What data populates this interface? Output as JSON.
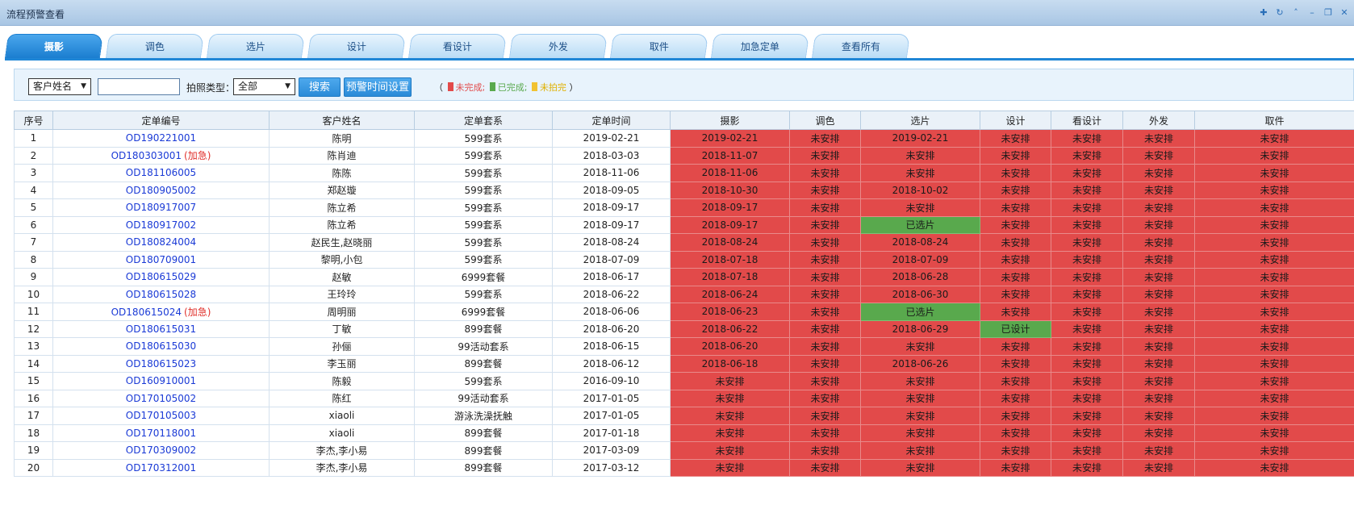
{
  "window": {
    "title": "流程预警查看"
  },
  "tabs": [
    "摄影",
    "调色",
    "选片",
    "设计",
    "看设计",
    "外发",
    "取件",
    "加急定单",
    "查看所有"
  ],
  "active_tab": "摄影",
  "search": {
    "field_select": "客户姓名",
    "field_input": "",
    "type_label": "拍照类型：",
    "type_select": "全部",
    "search_button": "搜索",
    "warn_button": "预警时间设置",
    "legend_open": "（",
    "legend_incomplete": "未完成;",
    "legend_done": "已完成;",
    "legend_notshot": "未拍完",
    "legend_close": "）",
    "colors": {
      "incomplete": "#e24a4a",
      "done": "#59a94d",
      "notshot": "#f1c232"
    }
  },
  "table": {
    "headers": [
      "序号",
      "定单编号",
      "客户姓名",
      "定单套系",
      "定单时间",
      "摄影",
      "调色",
      "选片",
      "设计",
      "看设计",
      "外发",
      "取件"
    ],
    "rows": [
      {
        "no": "1",
        "order": "OD190221001",
        "urg": "",
        "name": "陈明",
        "pkg": "599套系",
        "date": "2019-02-21",
        "stages": [
          "2019-02-21",
          "未安排",
          "2019-02-21",
          "未安排",
          "未安排",
          "未安排",
          "未安排"
        ],
        "status": [
          "r",
          "r",
          "r",
          "r",
          "r",
          "r",
          "r"
        ]
      },
      {
        "no": "2",
        "order": "OD180303001",
        "urg": "(加急)",
        "name": "陈肖迪",
        "pkg": "599套系",
        "date": "2018-03-03",
        "stages": [
          "2018-11-07",
          "未安排",
          "未安排",
          "未安排",
          "未安排",
          "未安排",
          "未安排"
        ],
        "status": [
          "r",
          "r",
          "r",
          "r",
          "r",
          "r",
          "r"
        ]
      },
      {
        "no": "3",
        "order": "OD181106005",
        "urg": "",
        "name": "陈陈",
        "pkg": "599套系",
        "date": "2018-11-06",
        "stages": [
          "2018-11-06",
          "未安排",
          "未安排",
          "未安排",
          "未安排",
          "未安排",
          "未安排"
        ],
        "status": [
          "r",
          "r",
          "r",
          "r",
          "r",
          "r",
          "r"
        ]
      },
      {
        "no": "4",
        "order": "OD180905002",
        "urg": "",
        "name": "郑赵璇",
        "pkg": "599套系",
        "date": "2018-09-05",
        "stages": [
          "2018-10-30",
          "未安排",
          "2018-10-02",
          "未安排",
          "未安排",
          "未安排",
          "未安排"
        ],
        "status": [
          "r",
          "r",
          "r",
          "r",
          "r",
          "r",
          "r"
        ]
      },
      {
        "no": "5",
        "order": "OD180917007",
        "urg": "",
        "name": "陈立希",
        "pkg": "599套系",
        "date": "2018-09-17",
        "stages": [
          "2018-09-17",
          "未安排",
          "未安排",
          "未安排",
          "未安排",
          "未安排",
          "未安排"
        ],
        "status": [
          "r",
          "r",
          "r",
          "r",
          "r",
          "r",
          "r"
        ]
      },
      {
        "no": "6",
        "order": "OD180917002",
        "urg": "",
        "name": "陈立希",
        "pkg": "599套系",
        "date": "2018-09-17",
        "stages": [
          "2018-09-17",
          "未安排",
          "已选片",
          "未安排",
          "未安排",
          "未安排",
          "未安排"
        ],
        "status": [
          "r",
          "r",
          "g",
          "r",
          "r",
          "r",
          "r"
        ]
      },
      {
        "no": "7",
        "order": "OD180824004",
        "urg": "",
        "name": "赵民生,赵晓丽",
        "pkg": "599套系",
        "date": "2018-08-24",
        "stages": [
          "2018-08-24",
          "未安排",
          "2018-08-24",
          "未安排",
          "未安排",
          "未安排",
          "未安排"
        ],
        "status": [
          "r",
          "r",
          "r",
          "r",
          "r",
          "r",
          "r"
        ]
      },
      {
        "no": "8",
        "order": "OD180709001",
        "urg": "",
        "name": "黎明,小包",
        "pkg": "599套系",
        "date": "2018-07-09",
        "stages": [
          "2018-07-18",
          "未安排",
          "2018-07-09",
          "未安排",
          "未安排",
          "未安排",
          "未安排"
        ],
        "status": [
          "r",
          "r",
          "r",
          "r",
          "r",
          "r",
          "r"
        ]
      },
      {
        "no": "9",
        "order": "OD180615029",
        "urg": "",
        "name": "赵敏",
        "pkg": "6999套餐",
        "date": "2018-06-17",
        "stages": [
          "2018-07-18",
          "未安排",
          "2018-06-28",
          "未安排",
          "未安排",
          "未安排",
          "未安排"
        ],
        "status": [
          "r",
          "r",
          "r",
          "r",
          "r",
          "r",
          "r"
        ]
      },
      {
        "no": "10",
        "order": "OD180615028",
        "urg": "",
        "name": "王玲玲",
        "pkg": "599套系",
        "date": "2018-06-22",
        "stages": [
          "2018-06-24",
          "未安排",
          "2018-06-30",
          "未安排",
          "未安排",
          "未安排",
          "未安排"
        ],
        "status": [
          "r",
          "r",
          "r",
          "r",
          "r",
          "r",
          "r"
        ]
      },
      {
        "no": "11",
        "order": "OD180615024",
        "urg": "(加急)",
        "name": "周明丽",
        "pkg": "6999套餐",
        "date": "2018-06-06",
        "stages": [
          "2018-06-23",
          "未安排",
          "已选片",
          "未安排",
          "未安排",
          "未安排",
          "未安排"
        ],
        "status": [
          "r",
          "r",
          "g",
          "r",
          "r",
          "r",
          "r"
        ]
      },
      {
        "no": "12",
        "order": "OD180615031",
        "urg": "",
        "name": "丁敏",
        "pkg": "899套餐",
        "date": "2018-06-20",
        "stages": [
          "2018-06-22",
          "未安排",
          "2018-06-29",
          "已设计",
          "未安排",
          "未安排",
          "未安排"
        ],
        "status": [
          "r",
          "r",
          "r",
          "g",
          "r",
          "r",
          "r"
        ]
      },
      {
        "no": "13",
        "order": "OD180615030",
        "urg": "",
        "name": "孙俪",
        "pkg": "99活动套系",
        "date": "2018-06-15",
        "stages": [
          "2018-06-20",
          "未安排",
          "未安排",
          "未安排",
          "未安排",
          "未安排",
          "未安排"
        ],
        "status": [
          "r",
          "r",
          "r",
          "r",
          "r",
          "r",
          "r"
        ]
      },
      {
        "no": "14",
        "order": "OD180615023",
        "urg": "",
        "name": "李玉丽",
        "pkg": "899套餐",
        "date": "2018-06-12",
        "stages": [
          "2018-06-18",
          "未安排",
          "2018-06-26",
          "未安排",
          "未安排",
          "未安排",
          "未安排"
        ],
        "status": [
          "r",
          "r",
          "r",
          "r",
          "r",
          "r",
          "r"
        ]
      },
      {
        "no": "15",
        "order": "OD160910001",
        "urg": "",
        "name": "陈毅",
        "pkg": "599套系",
        "date": "2016-09-10",
        "stages": [
          "未安排",
          "未安排",
          "未安排",
          "未安排",
          "未安排",
          "未安排",
          "未安排"
        ],
        "status": [
          "r",
          "r",
          "r",
          "r",
          "r",
          "r",
          "r"
        ]
      },
      {
        "no": "16",
        "order": "OD170105002",
        "urg": "",
        "name": "陈红",
        "pkg": "99活动套系",
        "date": "2017-01-05",
        "stages": [
          "未安排",
          "未安排",
          "未安排",
          "未安排",
          "未安排",
          "未安排",
          "未安排"
        ],
        "status": [
          "r",
          "r",
          "r",
          "r",
          "r",
          "r",
          "r"
        ]
      },
      {
        "no": "17",
        "order": "OD170105003",
        "urg": "",
        "name": "xiaoli",
        "pkg": "游泳洗澡抚触",
        "date": "2017-01-05",
        "stages": [
          "未安排",
          "未安排",
          "未安排",
          "未安排",
          "未安排",
          "未安排",
          "未安排"
        ],
        "status": [
          "r",
          "r",
          "r",
          "r",
          "r",
          "r",
          "r"
        ]
      },
      {
        "no": "18",
        "order": "OD170118001",
        "urg": "",
        "name": "xiaoli",
        "pkg": "899套餐",
        "date": "2017-01-18",
        "stages": [
          "未安排",
          "未安排",
          "未安排",
          "未安排",
          "未安排",
          "未安排",
          "未安排"
        ],
        "status": [
          "r",
          "r",
          "r",
          "r",
          "r",
          "r",
          "r"
        ]
      },
      {
        "no": "19",
        "order": "OD170309002",
        "urg": "",
        "name": "李杰,李小易",
        "pkg": "899套餐",
        "date": "2017-03-09",
        "stages": [
          "未安排",
          "未安排",
          "未安排",
          "未安排",
          "未安排",
          "未安排",
          "未安排"
        ],
        "status": [
          "r",
          "r",
          "r",
          "r",
          "r",
          "r",
          "r"
        ]
      },
      {
        "no": "20",
        "order": "OD170312001",
        "urg": "",
        "name": "李杰,李小易",
        "pkg": "899套餐",
        "date": "2017-03-12",
        "stages": [
          "未安排",
          "未安排",
          "未安排",
          "未安排",
          "未安排",
          "未安排",
          "未安排"
        ],
        "status": [
          "r",
          "r",
          "r",
          "r",
          "r",
          "r",
          "r"
        ]
      }
    ]
  }
}
